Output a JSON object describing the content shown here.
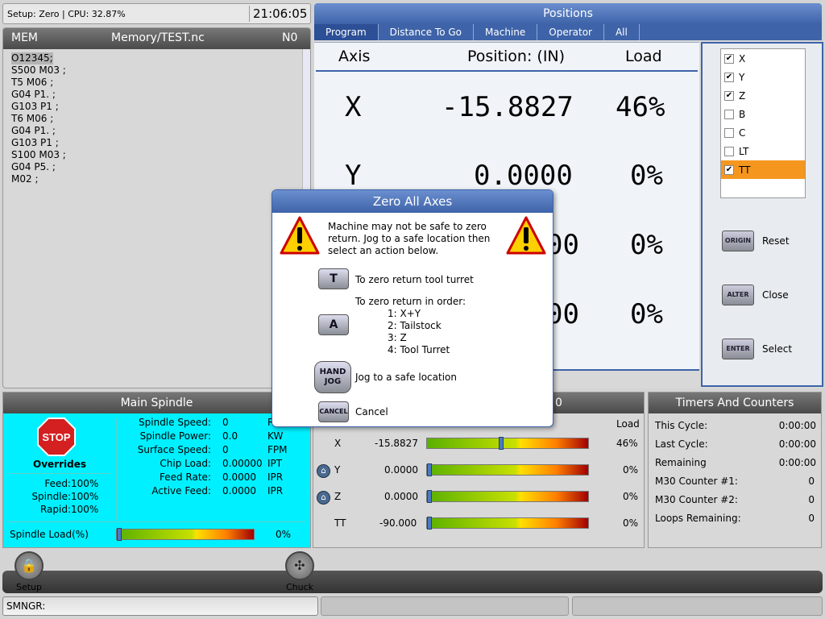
{
  "status": {
    "cpu_text": "Setup: Zero | CPU: 32.87%",
    "clock": "21:06:05"
  },
  "program": {
    "mode": "MEM",
    "file": "Memory/TEST.nc",
    "seq": "N0",
    "lines": [
      "O12345;",
      "S500 M03 ;",
      "T5 M06 ;",
      "G04 P1. ;",
      "G103 P1 ;",
      "T6 M06 ;",
      "G04 P1. ;",
      "G103 P1 ;",
      "S100 M03 ;",
      "G04 P5. ;",
      "M02 ;"
    ]
  },
  "positions": {
    "title": "Positions",
    "tabs": [
      "Program",
      "Distance To Go",
      "Machine",
      "Operator",
      "All"
    ],
    "active_tab": "Program",
    "headers": {
      "axis": "Axis",
      "position": "Position:  (IN)",
      "load": "Load"
    },
    "rows": [
      {
        "axis": "X",
        "position": "-15.8827",
        "load": "46%"
      },
      {
        "axis": "Y",
        "position": "0.0000",
        "load": "0%"
      },
      {
        "axis": "",
        "position": "00",
        "load": "0%"
      },
      {
        "axis": "",
        "position": "00",
        "load": "0%"
      }
    ]
  },
  "axis_select": {
    "items": [
      {
        "label": "X",
        "checked": true
      },
      {
        "label": "Y",
        "checked": true
      },
      {
        "label": "Z",
        "checked": true
      },
      {
        "label": "B",
        "checked": false
      },
      {
        "label": "C",
        "checked": false
      },
      {
        "label": "LT",
        "checked": false
      },
      {
        "label": "TT",
        "checked": true
      }
    ],
    "keys": [
      {
        "key": "ORIGIN",
        "label": "Reset"
      },
      {
        "key": "ALTER",
        "label": "Close"
      },
      {
        "key": "ENTER",
        "label": "Select"
      }
    ]
  },
  "spindle": {
    "title": "Main Spindle",
    "stop_label": "STOP",
    "overrides_label": "Overrides",
    "overrides": [
      {
        "name": "Feed:",
        "value": "100%"
      },
      {
        "name": "Spindle:",
        "value": "100%"
      },
      {
        "name": "Rapid:",
        "value": "100%"
      }
    ],
    "stats": [
      {
        "name": "Spindle Speed:",
        "value": "0",
        "unit": "R"
      },
      {
        "name": "Spindle Power:",
        "value": "0.0",
        "unit": "KW"
      },
      {
        "name": "Surface Speed:",
        "value": "0",
        "unit": "FPM"
      },
      {
        "name": "Chip Load:",
        "value": "0.00000",
        "unit": "IPT"
      },
      {
        "name": "Feed Rate:",
        "value": "0.0000",
        "unit": "IPR"
      },
      {
        "name": "Active Feed:",
        "value": "0.0000",
        "unit": "IPR"
      }
    ],
    "load_label": "Spindle Load(%)",
    "load_value": "0%",
    "load_fraction": 0
  },
  "load_panel": {
    "title_fragment": "0",
    "load_header": "Load",
    "rows": [
      {
        "axis": "X",
        "value": "-15.8827",
        "load": "46%",
        "fraction": 0.46,
        "home": false
      },
      {
        "axis": "Y",
        "value": "0.0000",
        "load": "0%",
        "fraction": 0,
        "home": true
      },
      {
        "axis": "Z",
        "value": "0.0000",
        "load": "0%",
        "fraction": 0,
        "home": true
      },
      {
        "axis": "TT",
        "value": "-90.000",
        "load": "0%",
        "fraction": 0,
        "home": false
      }
    ]
  },
  "timers": {
    "title": "Timers And Counters",
    "rows": [
      {
        "name": "This Cycle:",
        "value": "0:00:00"
      },
      {
        "name": "Last Cycle:",
        "value": "0:00:00"
      },
      {
        "name": "Remaining",
        "value": "0:00:00"
      },
      {
        "name": "M30 Counter #1:",
        "value": "0"
      },
      {
        "name": "M30 Counter #2:",
        "value": "0"
      },
      {
        "name": "Loops Remaining:",
        "value": "0"
      }
    ]
  },
  "toolbar": {
    "setup_label": "Setup",
    "chuck_label": "Chuck"
  },
  "command": {
    "prompt": "SMNGR:"
  },
  "dialog": {
    "title": "Zero All Axes",
    "message": "Machine may not be safe to zero return. Jog to a safe location then select an action below.",
    "options": [
      {
        "key": "T",
        "text": "To zero return tool turret"
      },
      {
        "key": "A",
        "text": "To zero return in order:",
        "steps": [
          "1: X+Y",
          "2: Tailstock",
          "3: Z",
          "4: Tool Turret"
        ]
      },
      {
        "key": "HAND JOG",
        "text": "Jog to a safe location"
      },
      {
        "key": "CANCEL",
        "text": "Cancel"
      }
    ]
  },
  "colors": {
    "accent": "#3e63a8",
    "selection": "#f5961e",
    "spindle_bg": "#00f0ff"
  }
}
